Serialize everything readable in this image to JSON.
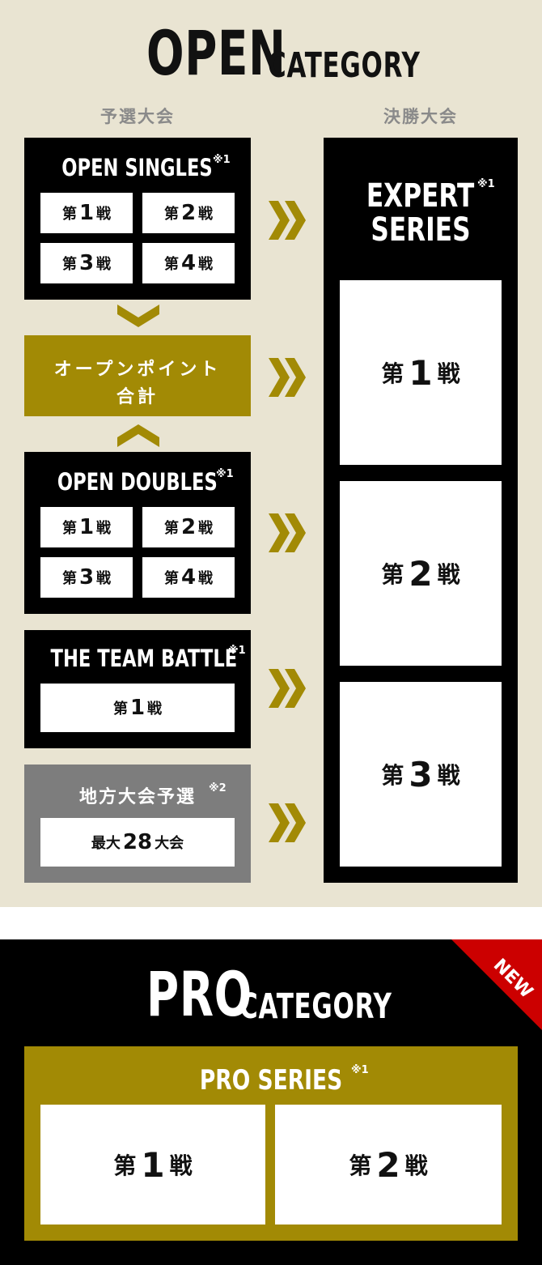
{
  "open": {
    "title_main": "OPEN",
    "title_sub": "CATEGORY",
    "qualifier_label": "予選大会",
    "final_label": "決勝大会",
    "singles": {
      "title": "OPEN SINGLES",
      "note": "※1",
      "rounds": [
        {
          "prefix": "第",
          "num": "1",
          "suffix": "戦"
        },
        {
          "prefix": "第",
          "num": "2",
          "suffix": "戦"
        },
        {
          "prefix": "第",
          "num": "3",
          "suffix": "戦"
        },
        {
          "prefix": "第",
          "num": "4",
          "suffix": "戦"
        }
      ]
    },
    "points": {
      "line1": "オープンポイント",
      "line2": "合計"
    },
    "doubles": {
      "title": "OPEN DOUBLES",
      "note": "※1",
      "rounds": [
        {
          "prefix": "第",
          "num": "1",
          "suffix": "戦"
        },
        {
          "prefix": "第",
          "num": "2",
          "suffix": "戦"
        },
        {
          "prefix": "第",
          "num": "3",
          "suffix": "戦"
        },
        {
          "prefix": "第",
          "num": "4",
          "suffix": "戦"
        }
      ]
    },
    "team": {
      "title": "THE TEAM BATTLE",
      "note": "※1",
      "round": {
        "prefix": "第",
        "num": "1",
        "suffix": "戦"
      }
    },
    "regional": {
      "title": "地方大会予選",
      "note": "※2",
      "detail": {
        "prefix": "最大",
        "num": "28",
        "suffix": "大会"
      }
    },
    "expert": {
      "title_line1": "EXPERT",
      "title_line2": "SERIES",
      "note": "※1",
      "rounds": [
        {
          "prefix": "第",
          "num": "1",
          "suffix": "戦"
        },
        {
          "prefix": "第",
          "num": "2",
          "suffix": "戦"
        },
        {
          "prefix": "第",
          "num": "3",
          "suffix": "戦"
        }
      ]
    }
  },
  "pro": {
    "title_main": "PRO",
    "title_sub": "CATEGORY",
    "badge": "NEW",
    "series": {
      "title": "PRO SERIES",
      "note": "※1",
      "rounds": [
        {
          "prefix": "第",
          "num": "1",
          "suffix": "戦"
        },
        {
          "prefix": "第",
          "num": "2",
          "suffix": "戦"
        }
      ]
    }
  },
  "colors": {
    "open_bg": "#e9e4d2",
    "gold": "#a28a05",
    "gray_box": "#7d7d7d",
    "ribbon_red": "#cc0000"
  }
}
